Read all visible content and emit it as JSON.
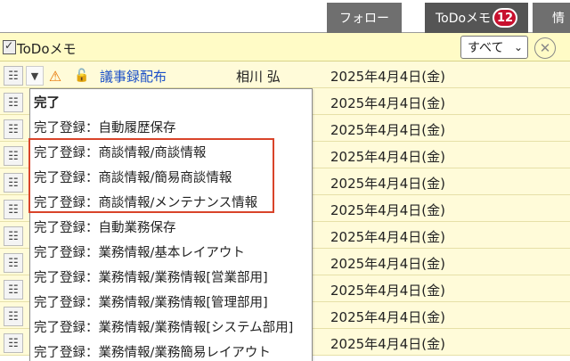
{
  "tabs": {
    "follow": "フォロー",
    "todo": "ToDoメモ",
    "todo_badge": "12",
    "info": "情"
  },
  "panel": {
    "title": "ToDoメモ",
    "filter_value": "すべて",
    "filter_options": [
      "すべて"
    ]
  },
  "first_row": {
    "link": "議事録配布",
    "person": "相川 弘",
    "date": "2025年4月4日(金)"
  },
  "rows": [
    {
      "date": "2025年4月4日(金)"
    },
    {
      "date": "2025年4月4日(金)"
    },
    {
      "date": "2025年4月4日(金)"
    },
    {
      "date": "2025年4月4日(金)"
    },
    {
      "date": "2025年4月4日(金)"
    },
    {
      "date": "2025年4月4日(金)"
    },
    {
      "date": "2025年4月4日(金)"
    },
    {
      "date": "2025年4月4日(金)"
    },
    {
      "date": "2025年4月4日(金)"
    },
    {
      "date": "2025年4月4日(金)"
    }
  ],
  "menu": {
    "items": [
      "完了",
      "完了登録：自動履歴保存",
      "完了登録：商談情報/商談情報",
      "完了登録：商談情報/簡易商談情報",
      "完了登録：商談情報/メンテナンス情報",
      "完了登録：自動業務保存",
      "完了登録：業務情報/基本レイアウト",
      "完了登録：業務情報/業務情報[営業部用]",
      "完了登録：業務情報/業務情報[管理部用]",
      "完了登録：業務情報/業務情報[システム部用]",
      "完了登録：業務情報/業務簡易レイアウト"
    ]
  },
  "colors": {
    "accent_badge": "#c8102e",
    "row_background": "#fffbd9",
    "highlight_border": "#d9442a",
    "link": "#1a4fc8"
  }
}
